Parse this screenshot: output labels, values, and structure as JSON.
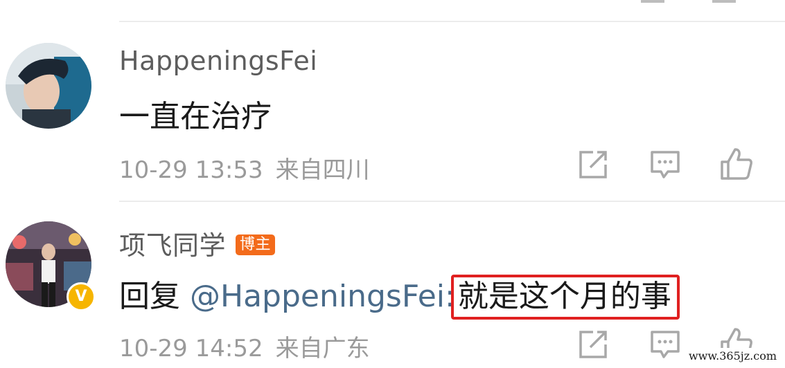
{
  "comments": [
    {
      "username": "HappeningsFei",
      "text": "一直在治疗",
      "time": "10-29 13:53",
      "location": "来自四川"
    },
    {
      "username": "项飞同学",
      "badge": "博主",
      "verified_mark": "V",
      "reply_prefix": "回复 ",
      "mention": "@HappeningsFei:",
      "text": "就是这个月的事",
      "time": "10-29 14:52",
      "location": "来自广东"
    }
  ],
  "icons": {
    "share": "share-icon",
    "comment": "comment-icon",
    "like": "thumbs-up-icon"
  },
  "colors": {
    "username": "#5d5d5d",
    "meta": "#9a9a9a",
    "mention": "#4a6b8a",
    "badge": "#f36b1b",
    "highlight_box": "#e02020",
    "verified": "#f6b500"
  },
  "watermark": "www.365jz.com"
}
